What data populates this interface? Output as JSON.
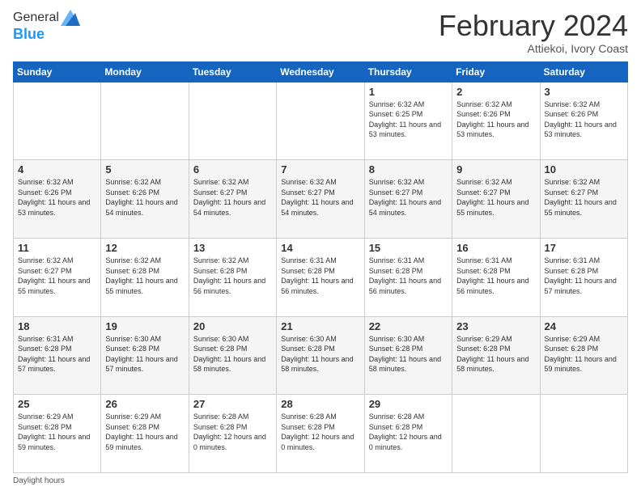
{
  "logo": {
    "line1": "General",
    "line2": "Blue"
  },
  "header": {
    "month": "February 2024",
    "location": "Attiekoi, Ivory Coast"
  },
  "weekdays": [
    "Sunday",
    "Monday",
    "Tuesday",
    "Wednesday",
    "Thursday",
    "Friday",
    "Saturday"
  ],
  "weeks": [
    [
      {
        "day": "",
        "info": ""
      },
      {
        "day": "",
        "info": ""
      },
      {
        "day": "",
        "info": ""
      },
      {
        "day": "",
        "info": ""
      },
      {
        "day": "1",
        "sunrise": "6:32 AM",
        "sunset": "6:25 PM",
        "daylight": "11 hours and 53 minutes."
      },
      {
        "day": "2",
        "sunrise": "6:32 AM",
        "sunset": "6:26 PM",
        "daylight": "11 hours and 53 minutes."
      },
      {
        "day": "3",
        "sunrise": "6:32 AM",
        "sunset": "6:26 PM",
        "daylight": "11 hours and 53 minutes."
      }
    ],
    [
      {
        "day": "4",
        "sunrise": "6:32 AM",
        "sunset": "6:26 PM",
        "daylight": "11 hours and 53 minutes."
      },
      {
        "day": "5",
        "sunrise": "6:32 AM",
        "sunset": "6:26 PM",
        "daylight": "11 hours and 54 minutes."
      },
      {
        "day": "6",
        "sunrise": "6:32 AM",
        "sunset": "6:27 PM",
        "daylight": "11 hours and 54 minutes."
      },
      {
        "day": "7",
        "sunrise": "6:32 AM",
        "sunset": "6:27 PM",
        "daylight": "11 hours and 54 minutes."
      },
      {
        "day": "8",
        "sunrise": "6:32 AM",
        "sunset": "6:27 PM",
        "daylight": "11 hours and 54 minutes."
      },
      {
        "day": "9",
        "sunrise": "6:32 AM",
        "sunset": "6:27 PM",
        "daylight": "11 hours and 55 minutes."
      },
      {
        "day": "10",
        "sunrise": "6:32 AM",
        "sunset": "6:27 PM",
        "daylight": "11 hours and 55 minutes."
      }
    ],
    [
      {
        "day": "11",
        "sunrise": "6:32 AM",
        "sunset": "6:27 PM",
        "daylight": "11 hours and 55 minutes."
      },
      {
        "day": "12",
        "sunrise": "6:32 AM",
        "sunset": "6:28 PM",
        "daylight": "11 hours and 55 minutes."
      },
      {
        "day": "13",
        "sunrise": "6:32 AM",
        "sunset": "6:28 PM",
        "daylight": "11 hours and 56 minutes."
      },
      {
        "day": "14",
        "sunrise": "6:31 AM",
        "sunset": "6:28 PM",
        "daylight": "11 hours and 56 minutes."
      },
      {
        "day": "15",
        "sunrise": "6:31 AM",
        "sunset": "6:28 PM",
        "daylight": "11 hours and 56 minutes."
      },
      {
        "day": "16",
        "sunrise": "6:31 AM",
        "sunset": "6:28 PM",
        "daylight": "11 hours and 56 minutes."
      },
      {
        "day": "17",
        "sunrise": "6:31 AM",
        "sunset": "6:28 PM",
        "daylight": "11 hours and 57 minutes."
      }
    ],
    [
      {
        "day": "18",
        "sunrise": "6:31 AM",
        "sunset": "6:28 PM",
        "daylight": "11 hours and 57 minutes."
      },
      {
        "day": "19",
        "sunrise": "6:30 AM",
        "sunset": "6:28 PM",
        "daylight": "11 hours and 57 minutes."
      },
      {
        "day": "20",
        "sunrise": "6:30 AM",
        "sunset": "6:28 PM",
        "daylight": "11 hours and 58 minutes."
      },
      {
        "day": "21",
        "sunrise": "6:30 AM",
        "sunset": "6:28 PM",
        "daylight": "11 hours and 58 minutes."
      },
      {
        "day": "22",
        "sunrise": "6:30 AM",
        "sunset": "6:28 PM",
        "daylight": "11 hours and 58 minutes."
      },
      {
        "day": "23",
        "sunrise": "6:29 AM",
        "sunset": "6:28 PM",
        "daylight": "11 hours and 58 minutes."
      },
      {
        "day": "24",
        "sunrise": "6:29 AM",
        "sunset": "6:28 PM",
        "daylight": "11 hours and 59 minutes."
      }
    ],
    [
      {
        "day": "25",
        "sunrise": "6:29 AM",
        "sunset": "6:28 PM",
        "daylight": "11 hours and 59 minutes."
      },
      {
        "day": "26",
        "sunrise": "6:29 AM",
        "sunset": "6:28 PM",
        "daylight": "11 hours and 59 minutes."
      },
      {
        "day": "27",
        "sunrise": "6:28 AM",
        "sunset": "6:28 PM",
        "daylight": "12 hours and 0 minutes."
      },
      {
        "day": "28",
        "sunrise": "6:28 AM",
        "sunset": "6:28 PM",
        "daylight": "12 hours and 0 minutes."
      },
      {
        "day": "29",
        "sunrise": "6:28 AM",
        "sunset": "6:28 PM",
        "daylight": "12 hours and 0 minutes."
      },
      {
        "day": "",
        "info": ""
      },
      {
        "day": "",
        "info": ""
      }
    ]
  ],
  "footer": {
    "daylight_label": "Daylight hours"
  }
}
